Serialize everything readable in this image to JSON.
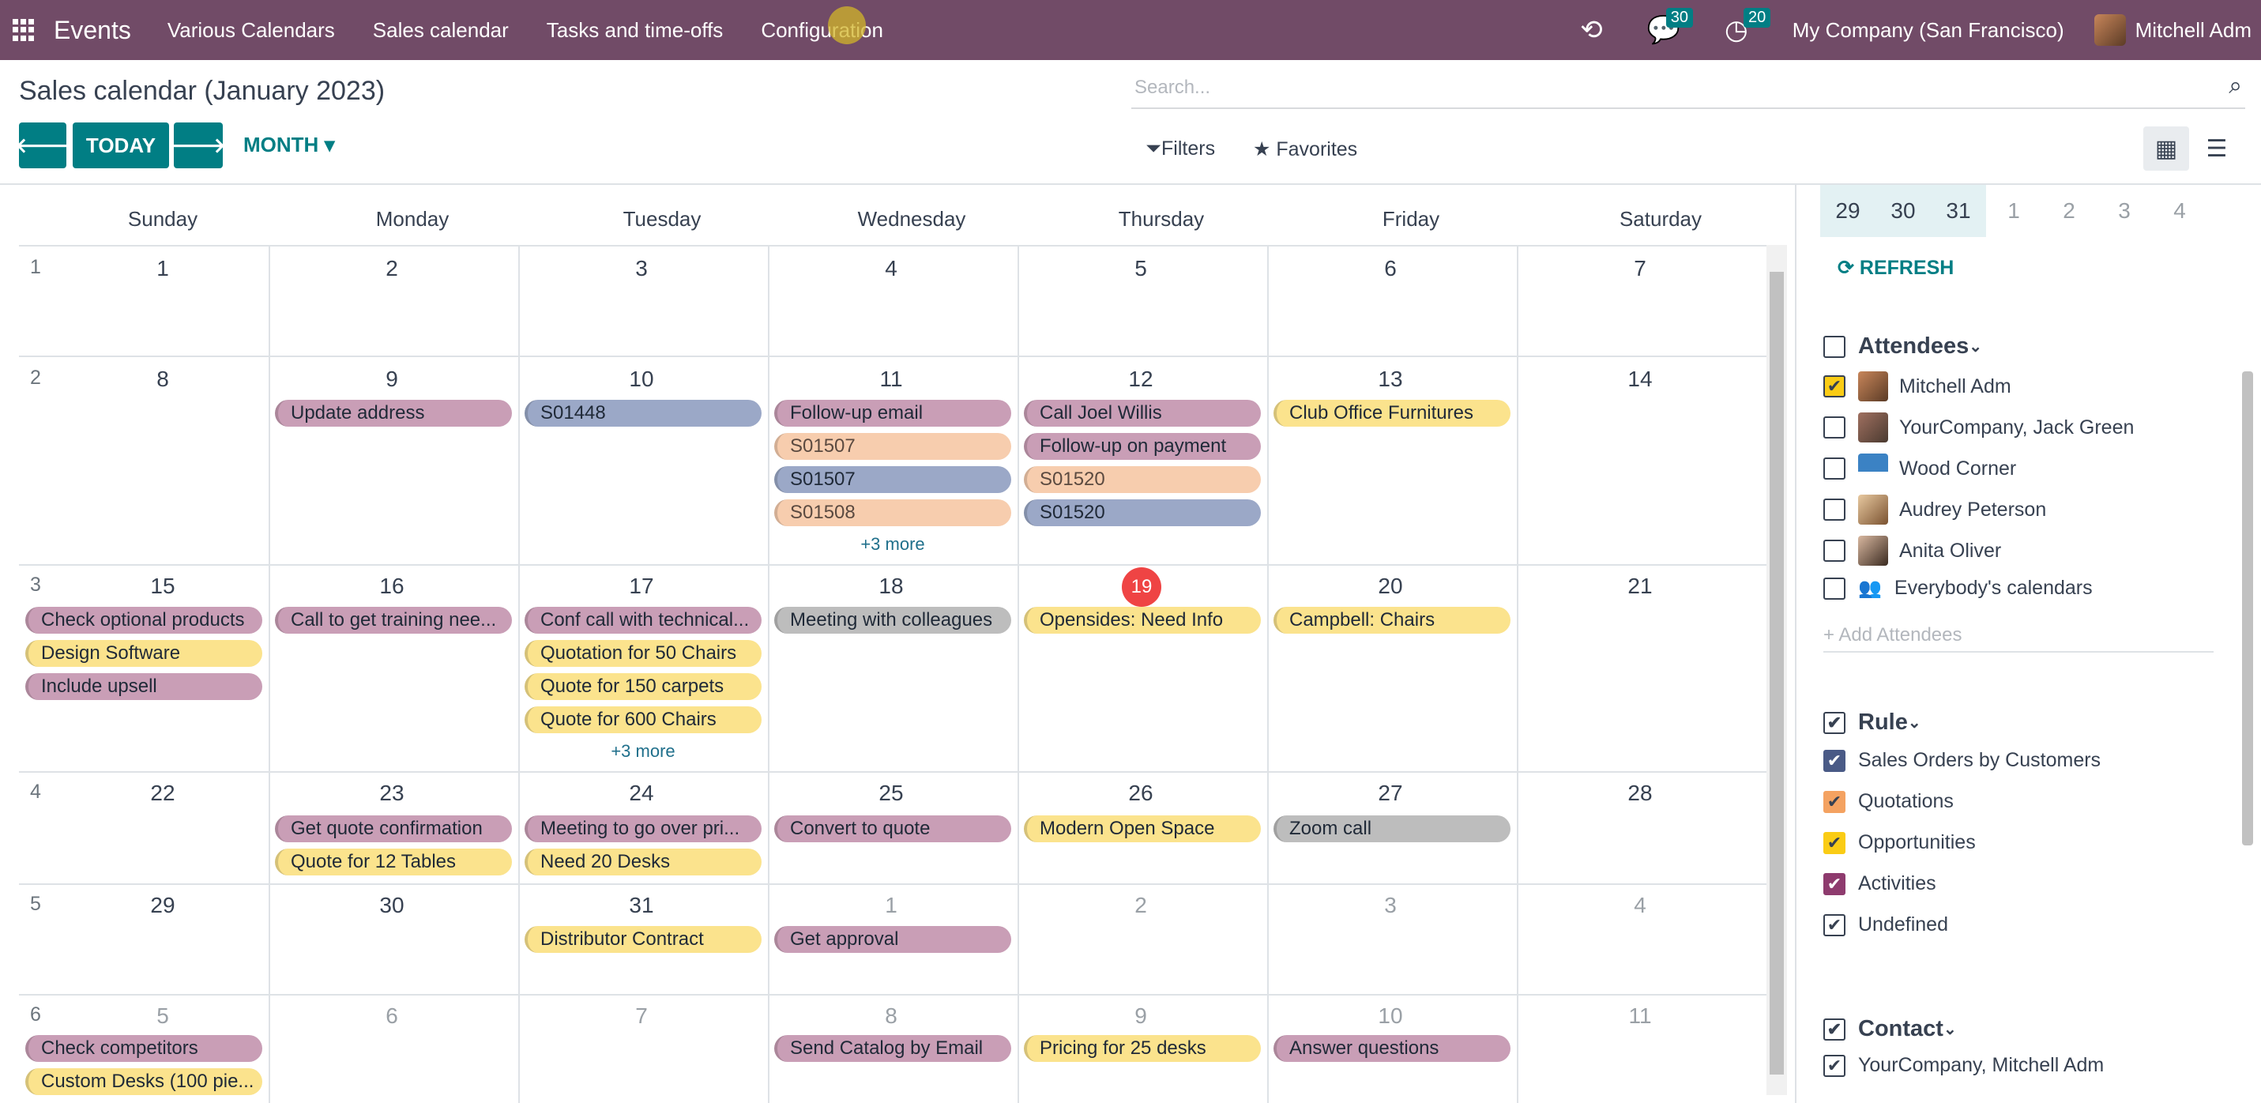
{
  "navbar": {
    "app_name": "Events",
    "menu": [
      "Various Calendars",
      "Sales calendar",
      "Tasks and time-offs",
      "Configuration"
    ],
    "messages_count": "30",
    "activities_count": "20",
    "company": "My Company (San Francisco)",
    "user": "Mitchell Adm"
  },
  "page": {
    "title": "Sales calendar (January 2023)",
    "search_placeholder": "Search...",
    "today_label": "TODAY",
    "month_label": "MONTH",
    "filters_label": "Filters",
    "favorites_label": "Favorites"
  },
  "calendar": {
    "weekdays": [
      "Sunday",
      "Monday",
      "Tuesday",
      "Wednesday",
      "Thursday",
      "Friday",
      "Saturday"
    ],
    "today": "19",
    "weeks": [
      {
        "week": "1",
        "days": [
          "1",
          "2",
          "3",
          "4",
          "5",
          "6",
          "7"
        ]
      },
      {
        "week": "2",
        "days": [
          "8",
          "9",
          "10",
          "11",
          "12",
          "13",
          "14"
        ]
      },
      {
        "week": "3",
        "days": [
          "15",
          "16",
          "17",
          "18",
          "19",
          "20",
          "21"
        ]
      },
      {
        "week": "4",
        "days": [
          "22",
          "23",
          "24",
          "25",
          "26",
          "27",
          "28"
        ]
      },
      {
        "week": "5",
        "days": [
          "29",
          "30",
          "31",
          "1",
          "2",
          "3",
          "4"
        ]
      },
      {
        "week": "6",
        "days": [
          "5",
          "6",
          "7",
          "8",
          "9",
          "10",
          "11"
        ]
      }
    ],
    "events": {
      "w2_mon": [
        "Update address"
      ],
      "w2_tue": [
        "S01448"
      ],
      "w2_wed": [
        "Follow-up email",
        "S01507",
        "S01507",
        "S01508"
      ],
      "w2_wed_more": "+3 more",
      "w2_thu": [
        "Call Joel Willis",
        "Follow-up on payment",
        "S01520",
        "S01520"
      ],
      "w2_fri": [
        "Club Office Furnitures"
      ],
      "w3_sun": [
        "Check optional products",
        "Design Software",
        "Include upsell"
      ],
      "w3_mon": [
        "Call to get training nee..."
      ],
      "w3_tue": [
        "Conf call with technical...",
        "Quotation for 50 Chairs",
        "Quote for 150 carpets",
        "Quote for 600 Chairs"
      ],
      "w3_tue_more": "+3 more",
      "w3_wed": [
        "Meeting with colleagues"
      ],
      "w3_thu": [
        "Opensides: Need Info"
      ],
      "w3_fri": [
        "Campbell: Chairs"
      ],
      "w4_mon": [
        "Get quote confirmation",
        "Quote for 12 Tables"
      ],
      "w4_tue": [
        "Meeting to go over pri...",
        "Need 20 Desks"
      ],
      "w4_wed": [
        "Convert to quote"
      ],
      "w4_thu": [
        "Modern Open Space"
      ],
      "w4_fri": [
        "Zoom call"
      ],
      "w5_tue": [
        "Distributor Contract"
      ],
      "w5_wed": [
        "Get approval"
      ],
      "w6_sun": [
        "Check competitors",
        "Custom Desks (100 pie..."
      ],
      "w6_wed": [
        "Send Catalog by Email"
      ],
      "w6_thu": [
        "Pricing for 25 desks"
      ],
      "w6_fri": [
        "Answer questions"
      ]
    }
  },
  "sidebar": {
    "mini_days": [
      "29",
      "30",
      "31",
      "1",
      "2",
      "3",
      "4"
    ],
    "refresh_label": "REFRESH",
    "attendees_title": "Attendees",
    "attendees": [
      "Mitchell Adm",
      "YourCompany, Jack Green",
      "Wood Corner",
      "Audrey Peterson",
      "Anita Oliver",
      "Everybody's calendars"
    ],
    "add_attendees": "+ Add Attendees",
    "rule_title": "Rule",
    "rules": [
      "Sales Orders by Customers",
      "Quotations",
      "Opportunities",
      "Activities",
      "Undefined"
    ],
    "contact_title": "Contact",
    "contacts": [
      "YourCompany, Mitchell Adm"
    ],
    "colors": {
      "navbar": "#714B67",
      "primary": "#017E84",
      "today": "#EF4444"
    }
  }
}
